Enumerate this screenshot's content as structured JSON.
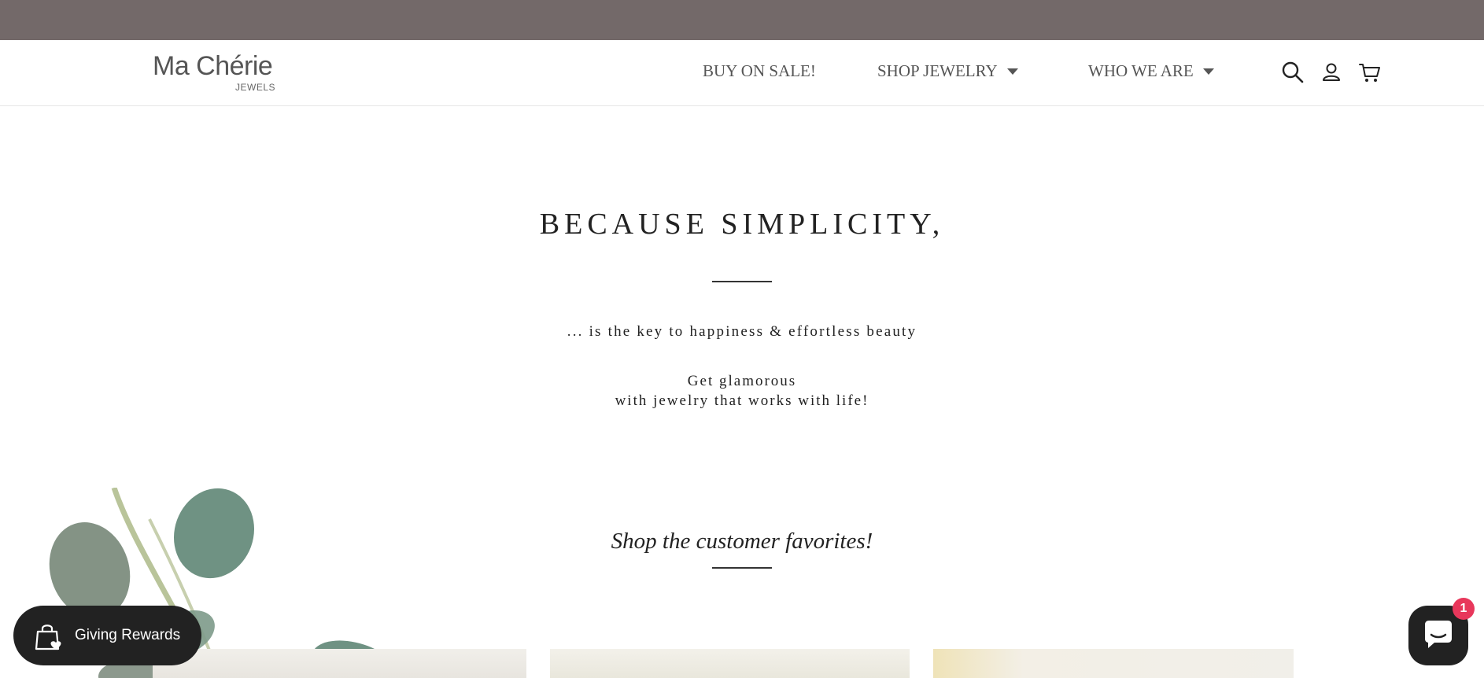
{
  "logo": {
    "main": "Ma Chérie",
    "sub": "JEWELS"
  },
  "nav": {
    "items": [
      {
        "label": "BUY ON SALE!",
        "has_dropdown": false
      },
      {
        "label": "SHOP JEWELRY",
        "has_dropdown": true
      },
      {
        "label": "WHO WE ARE",
        "has_dropdown": true
      }
    ],
    "icons": [
      "search-icon",
      "account-icon",
      "cart-icon"
    ]
  },
  "hero": {
    "title": "BECAUSE SIMPLICITY,",
    "tagline": "... is the key to happiness & effortless beauty",
    "subtext_line1": "Get glamorous",
    "subtext_line2": "with jewelry that works with life!"
  },
  "favorites": {
    "heading": "Shop the customer favorites!"
  },
  "rewards": {
    "label": "Giving Rewards",
    "icon": "shopping-bag-heart-icon"
  },
  "chat": {
    "badge_count": "1",
    "icon": "chat-icon"
  },
  "colors": {
    "top_bar": "#736969",
    "nav_text": "#555555",
    "widget_dark": "#222222",
    "badge": "#e8375b"
  }
}
